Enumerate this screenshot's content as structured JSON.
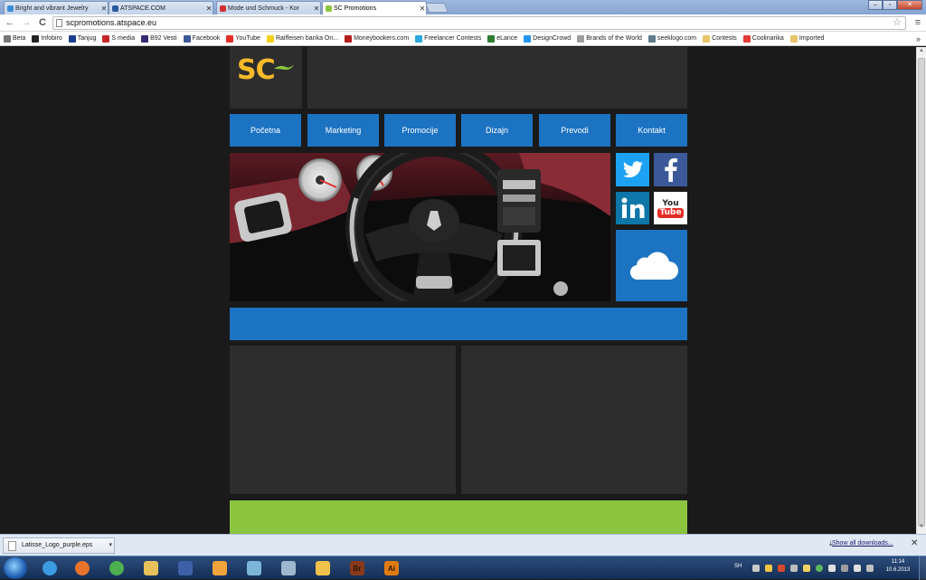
{
  "tabs": [
    {
      "title": "Bright and vibrant Jewelry",
      "fav": "#3a8fd6",
      "active": false
    },
    {
      "title": "ATSPACE.COM",
      "fav": "#2c5aa0",
      "active": false
    },
    {
      "title": "Mode und Schmuck - Kor",
      "fav": "#d23030",
      "active": false
    },
    {
      "title": "SC Promotions",
      "fav": "#8bc43f",
      "active": true
    }
  ],
  "window": {
    "minimize": "–",
    "maximize": "▫",
    "close": "✕"
  },
  "toolbar": {
    "back": "←",
    "forward": "→",
    "reload": "C",
    "url": "scpromotions.atspace.eu",
    "star": "☆",
    "menu": "≡"
  },
  "bookmarks": [
    {
      "label": "Beta",
      "color": "#777777"
    },
    {
      "label": "Infobiro",
      "color": "#222222"
    },
    {
      "label": "Tanjug",
      "color": "#1b3f8f"
    },
    {
      "label": "S media",
      "color": "#c62828"
    },
    {
      "label": "B92 Vesti",
      "color": "#3b2a73"
    },
    {
      "label": "Facebook",
      "color": "#3b5998"
    },
    {
      "label": "YouTube",
      "color": "#e52d27"
    },
    {
      "label": "Raiffeisen banka On...",
      "color": "#f4d01b"
    },
    {
      "label": "Moneybookers.com",
      "color": "#b71c1c"
    },
    {
      "label": "Freelancer Contests",
      "color": "#29a9e0"
    },
    {
      "label": "eLance",
      "color": "#2e7d32"
    },
    {
      "label": "DesignCrowd",
      "color": "#2196f3"
    },
    {
      "label": "Brands of the World",
      "color": "#9e9e9e"
    },
    {
      "label": "seeklogo.com",
      "color": "#607d8b"
    },
    {
      "label": "Contests",
      "color": "#e8c46a"
    },
    {
      "label": "Coolinarika",
      "color": "#e53935"
    },
    {
      "label": "Imported",
      "color": "#e8c46a"
    }
  ],
  "bookmarks_more": "»",
  "site": {
    "logo_text": "SC",
    "nav": [
      "Početna",
      "Marketing",
      "Promocije",
      "Dizajn",
      "Prevodi",
      "Kontakt"
    ],
    "social": {
      "twitter_color": "#1da1f2",
      "facebook_color": "#3b5998",
      "linkedin_color": "#0e76a8",
      "youtube_label_top": "You",
      "youtube_label_bottom": "Tube",
      "cloud_color": "#1c73c2"
    },
    "accent_blue": "#1c73c2",
    "accent_green": "#8bc43f",
    "logo_color": "#f7b929"
  },
  "downloads": {
    "file": "Latisse_Logo_purple.eps",
    "dropdown": "▾",
    "show_all": "Show all downloads...",
    "close": "✕"
  },
  "taskbar": {
    "apps": [
      {
        "name": "ie",
        "color": "#3c9ae0"
      },
      {
        "name": "firefox",
        "color": "#e8742b"
      },
      {
        "name": "chrome",
        "color": "#4caf50"
      },
      {
        "name": "explorer",
        "color": "#e7c25a"
      },
      {
        "name": "save",
        "color": "#3d5fa8"
      },
      {
        "name": "media",
        "color": "#f1a33c"
      },
      {
        "name": "app",
        "color": "#7bb6d8"
      },
      {
        "name": "calc",
        "color": "#9fb7cc"
      },
      {
        "name": "folder",
        "color": "#f0c24b"
      },
      {
        "name": "bridge",
        "color": "#8a3a1b"
      },
      {
        "name": "illustrator",
        "color": "#e07b0f"
      }
    ],
    "bridge_label": "Br",
    "illustrator_label": "Ai",
    "lang": "SH",
    "time": "11:14",
    "date": "10.6.2013"
  }
}
